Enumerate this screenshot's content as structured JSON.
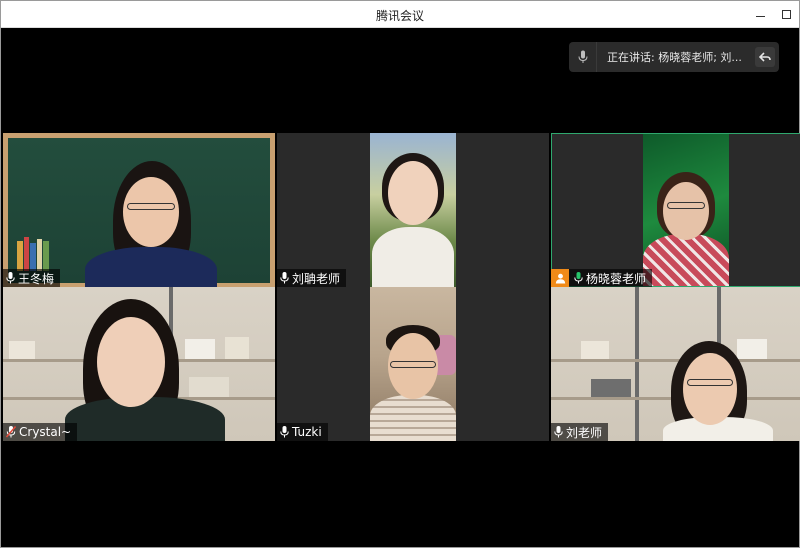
{
  "window": {
    "title": "腾讯会议"
  },
  "speaking_banner": {
    "text": "正在讲话: 杨晓蓉老师; 刘..."
  },
  "participants": [
    {
      "name": "王冬梅",
      "mic": "on"
    },
    {
      "name": "刘聃老师",
      "mic": "on"
    },
    {
      "name": "杨晓蓉老师",
      "mic": "on",
      "host": true,
      "speaking": true
    },
    {
      "name": "Crystal~",
      "mic": "muted"
    },
    {
      "name": "Tuzki",
      "mic": "on"
    },
    {
      "name": "刘老师",
      "mic": "on"
    }
  ],
  "colors": {
    "active_border": "#2fa86e",
    "speaking_mic": "#27c46b",
    "muted_mic": "#e24a3b",
    "host_badge": "#f08a18"
  },
  "icons": {
    "mic": "mic-icon",
    "host": "host-icon",
    "back": "back-arrow-icon",
    "minimize": "minimize-icon",
    "maximize": "maximize-icon"
  }
}
